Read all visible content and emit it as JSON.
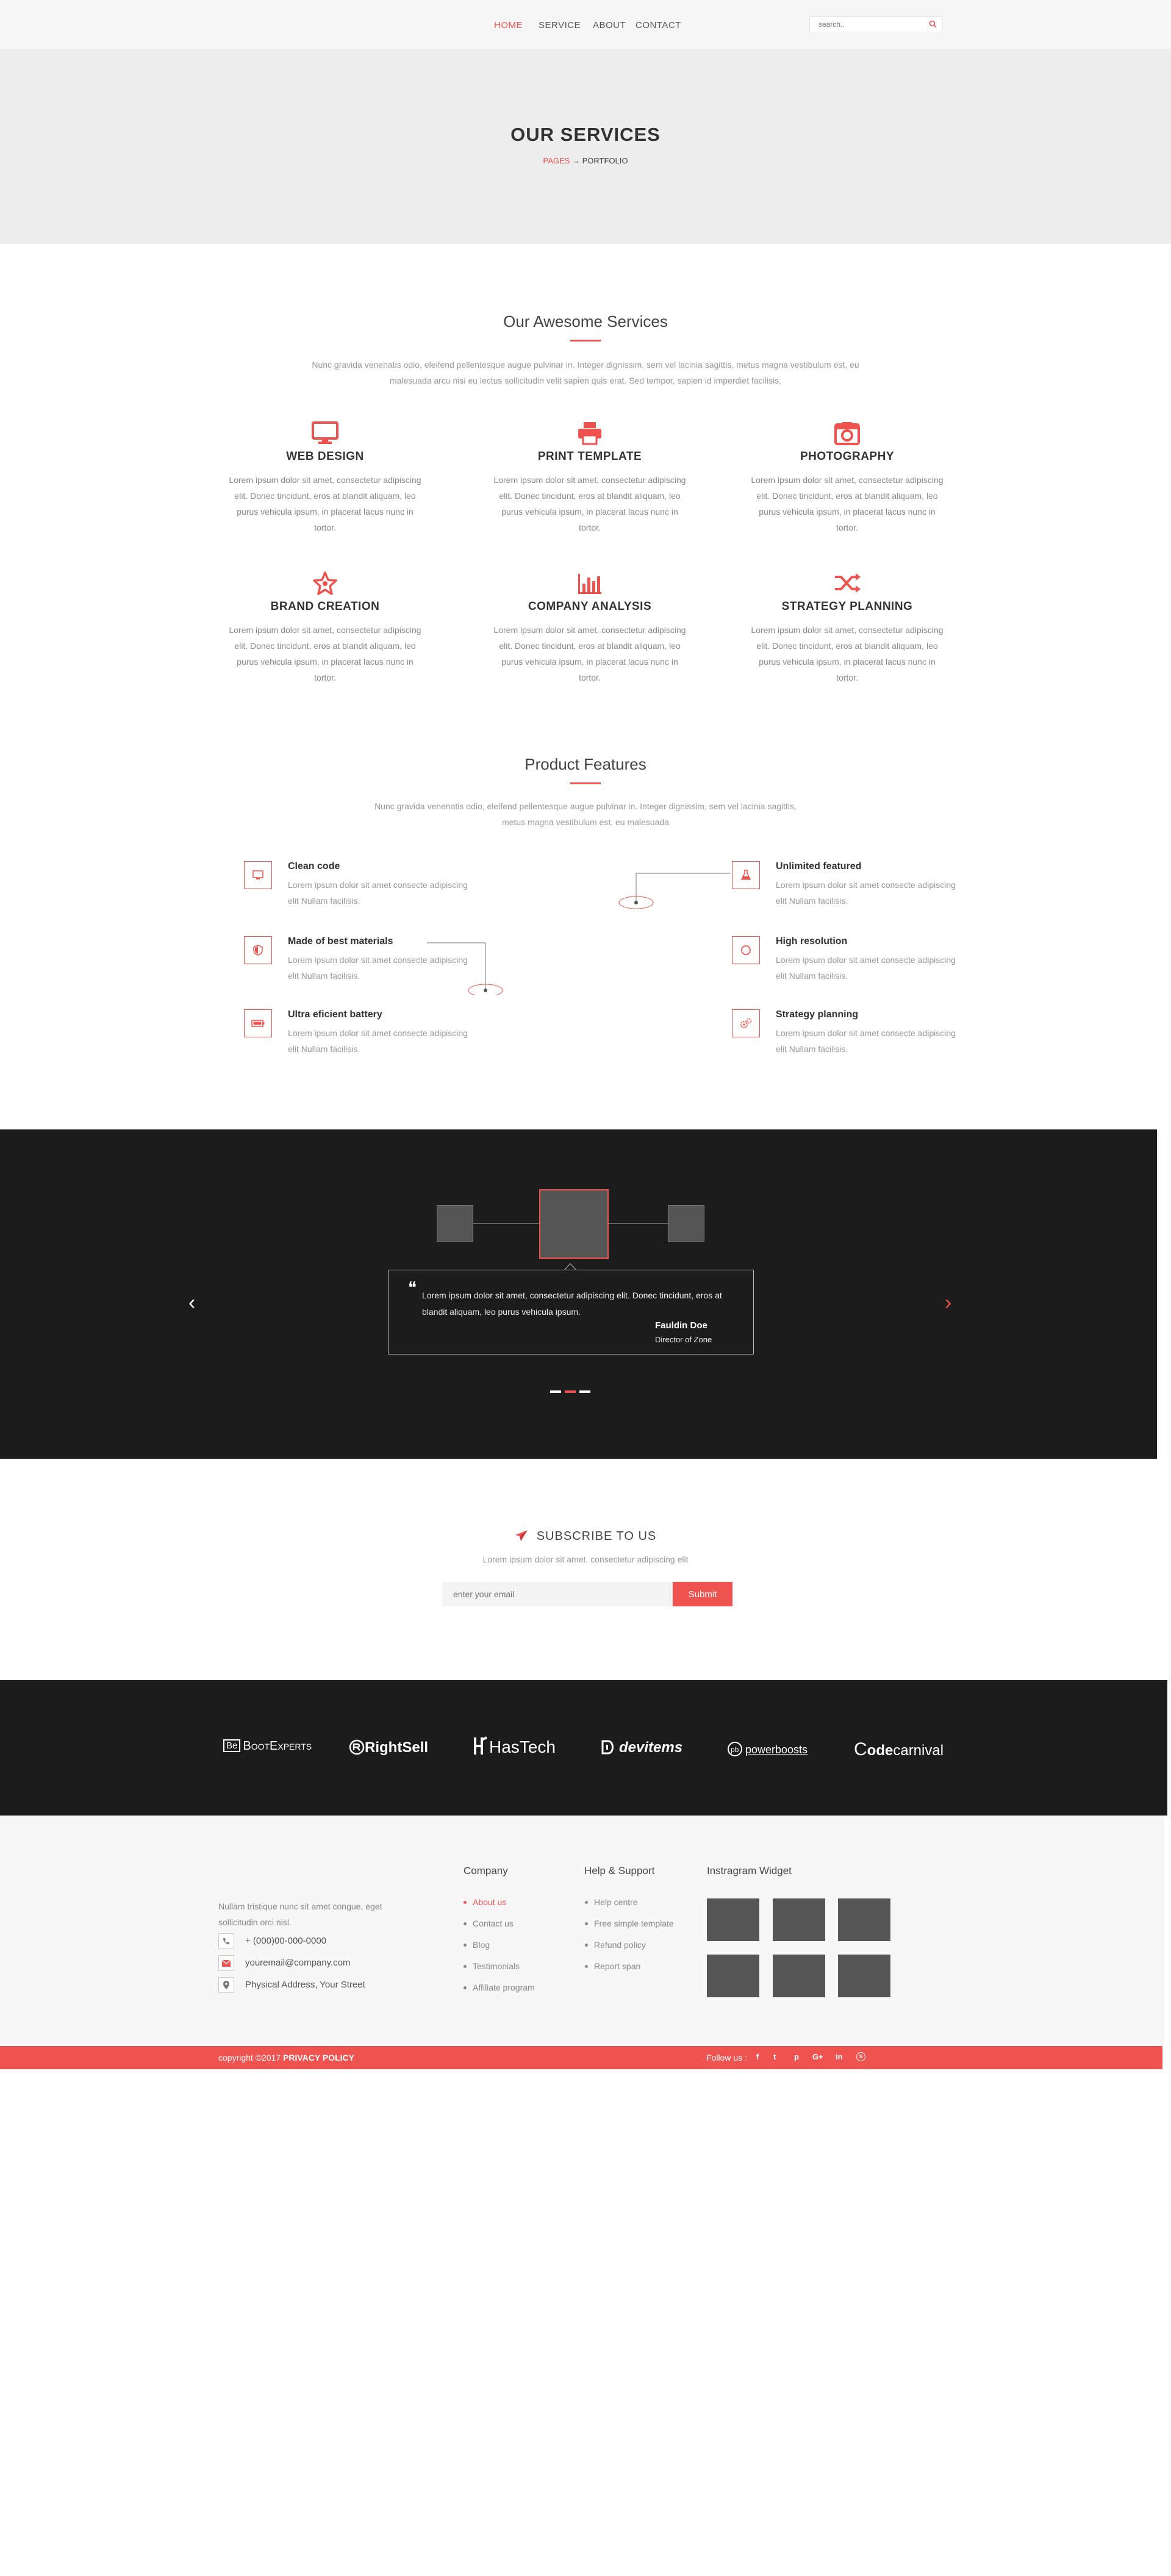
{
  "nav": {
    "items": [
      {
        "label": "HOME"
      },
      {
        "label": "SERVICE"
      },
      {
        "label": "ABOUT"
      },
      {
        "label": "CONTACT"
      }
    ],
    "active_color": "#ee5350",
    "search_placeholder": "search..",
    "search_icon": "search-icon"
  },
  "banner": {
    "title": "OUR SERVICES",
    "crumb_pages": "PAGES",
    "crumb_arrow": "→",
    "crumb_current": "PORTFOLIO"
  },
  "services": {
    "title": "Our Awesome Services",
    "desc": "Nunc gravida venenatis odio, eleifend pellentesque augue pulvinar in. Integer dignissim, sem vel lacinia sagittis, metus magna vestibulum est, eu malesuada arcu nisi eu lectus sollicitudin velit sapien quis erat. Sed tempor, sapien id imperdiet facilisis.",
    "items": [
      {
        "title": "WEB DESIGN",
        "icon": "monitor-icon",
        "text": "Lorem ipsum dolor sit amet, consectetur adipiscing elit. Donec tincidunt, eros at blandit aliquam, leo purus vehicula ipsum, in placerat lacus nunc in tortor."
      },
      {
        "title": "PRINT TEMPLATE",
        "icon": "printer-icon",
        "text": "Lorem ipsum dolor sit amet, consectetur adipiscing elit. Donec tincidunt, eros at blandit aliquam, leo purus vehicula ipsum, in placerat lacus nunc in tortor."
      },
      {
        "title": "PHOTOGRAPHY",
        "icon": "camera-icon",
        "text": "Lorem ipsum dolor sit amet, consectetur adipiscing elit. Donec tincidunt, eros at blandit aliquam, leo purus vehicula ipsum, in placerat lacus nunc in tortor."
      },
      {
        "title": "BRAND CREATION",
        "icon": "star-icon",
        "text": "Lorem ipsum dolor sit amet, consectetur adipiscing elit. Donec tincidunt, eros at blandit aliquam, leo purus vehicula ipsum, in placerat lacus nunc in tortor."
      },
      {
        "title": "COMPANY ANALYSIS",
        "icon": "bar-chart-icon",
        "text": "Lorem ipsum dolor sit amet, consectetur adipiscing elit. Donec tincidunt, eros at blandit aliquam, leo purus vehicula ipsum, in placerat lacus nunc in tortor."
      },
      {
        "title": "STRATEGY PLANNING",
        "icon": "shuffle-icon",
        "text": "Lorem ipsum dolor sit amet, consectetur adipiscing elit. Donec tincidunt, eros at blandit aliquam, leo purus vehicula ipsum, in placerat lacus nunc in tortor."
      }
    ]
  },
  "features": {
    "title": "Product Features",
    "desc": "Nunc gravida venenatis odio, eleifend pellentesque augue pulvinar in. Integer dignissim, sem vel lacinia sagittis, metus magna vestibulum est, eu malesuada",
    "items": [
      {
        "title": "Clean code",
        "icon": "monitor-icon",
        "text": "Lorem ipsum dolor sit amet consecte adipiscing elit Nullam facilisis."
      },
      {
        "title": "Made of best materials",
        "icon": "shield-icon",
        "text": "Lorem ipsum dolor sit amet consecte adipiscing elit Nullam facilisis."
      },
      {
        "title": "Ultra eficient battery",
        "icon": "battery-icon",
        "text": "Lorem ipsum dolor sit amet consecte adipiscing elit Nullam facilisis."
      },
      {
        "title": "Unlimited featured",
        "icon": "flask-icon",
        "text": "Lorem ipsum dolor sit amet consecte adipiscing elit Nullam facilisis."
      },
      {
        "title": "High resolution",
        "icon": "circle-icon",
        "text": "Lorem ipsum dolor sit amet consecte adipiscing elit Nullam facilisis."
      },
      {
        "title": "Strategy planning",
        "icon": "gears-icon",
        "text": "Lorem ipsum dolor sit amet consecte adipiscing elit Nullam facilisis."
      }
    ]
  },
  "testimonial": {
    "quote_mark": "❝",
    "text": "Lorem ipsum dolor sit amet, consectetur adipiscing elit. Donec tincidunt, eros at blandit aliquam, leo purus vehicula ipsum.",
    "name": "Fauldin Doe",
    "role": "Director of Zone",
    "prev_arrow": "‹",
    "next_arrow": "›"
  },
  "subscribe": {
    "title": "SUBSCRIBE TO US",
    "desc": "Lorem ipsum dolor sit amet, consectetur adipiscing elit",
    "placeholder": "enter your email",
    "button": "Submit"
  },
  "brands": [
    {
      "name": "BootExperts",
      "badge": "Be"
    },
    {
      "name": "RightSell"
    },
    {
      "name": "HasTech"
    },
    {
      "name": "devitems"
    },
    {
      "name": "powerboosts"
    },
    {
      "name_prefix": "C",
      "name_bold": "ode",
      "name_rest": "carnival"
    }
  ],
  "footer": {
    "about": "Nullam tristique nunc sit amet congue, eget sollicitudin orci nisl.",
    "phone": "+ (000)00-000-0000",
    "email": "youremail@company.com",
    "address": "Physical Address, Your Street",
    "company_heading": "Company",
    "company_links": [
      {
        "label": "About us"
      },
      {
        "label": "Contact us"
      },
      {
        "label": "Blog"
      },
      {
        "label": "Testimonials"
      },
      {
        "label": "Affiliate program"
      }
    ],
    "help_heading": "Help & Support",
    "help_links": [
      {
        "label": "Help centre"
      },
      {
        "label": "Free simple template"
      },
      {
        "label": "Refund  policy"
      },
      {
        "label": "Report span"
      }
    ],
    "instagram_heading": "Instragram Widget"
  },
  "bottom": {
    "copyright": "copyright  ©2017",
    "policy": "PRIVACY POLICY",
    "follow": "Follow us :",
    "socials": [
      {
        "label": "f",
        "icon": "facebook-icon"
      },
      {
        "label": "t",
        "icon": "twitter-icon"
      },
      {
        "label": "p",
        "icon": "pinterest-icon"
      },
      {
        "label": "G+",
        "icon": "google-plus-icon"
      },
      {
        "label": "in",
        "icon": "linkedin-icon"
      },
      {
        "label": "s",
        "icon": "skype-icon"
      }
    ]
  }
}
